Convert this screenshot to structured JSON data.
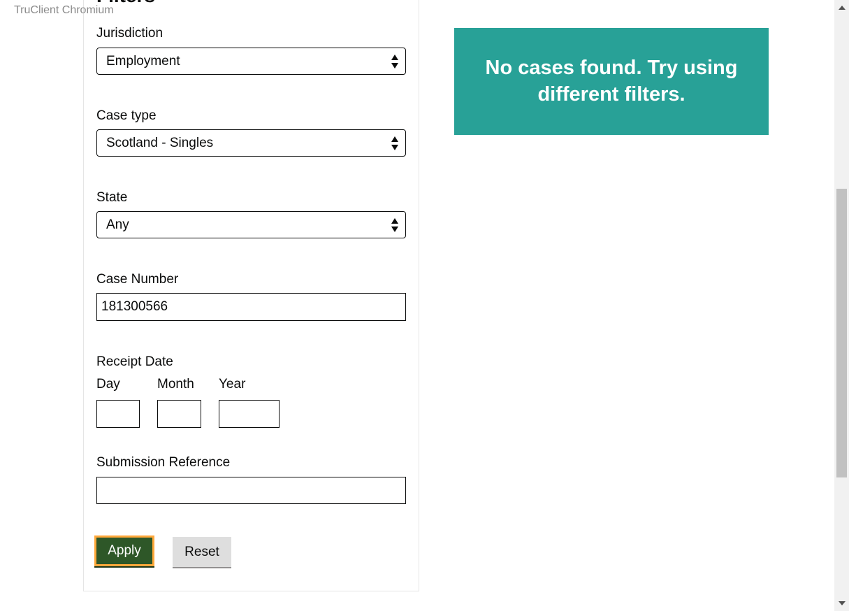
{
  "watermark": "TruClient Chromium",
  "panel": {
    "title": "Filters"
  },
  "filters": {
    "jurisdiction": {
      "label": "Jurisdiction",
      "value": "Employment"
    },
    "case_type": {
      "label": "Case type",
      "value": "Scotland - Singles"
    },
    "state": {
      "label": "State",
      "value": "Any"
    },
    "case_number": {
      "label": "Case Number",
      "value": "181300566"
    },
    "receipt_date": {
      "label": "Receipt Date",
      "day_label": "Day",
      "month_label": "Month",
      "year_label": "Year",
      "day": "",
      "month": "",
      "year": ""
    },
    "submission_reference": {
      "label": "Submission Reference",
      "value": ""
    }
  },
  "buttons": {
    "apply": "Apply",
    "reset": "Reset"
  },
  "notice": {
    "message": "No cases found. Try using different filters."
  },
  "colors": {
    "apply_bg": "#2e5728",
    "focus_outline": "#ffa83a",
    "notice_bg": "#28a197",
    "reset_bg": "#dedede"
  },
  "icons": {
    "select_arrows": "select-arrows-icon",
    "scroll_up": "scroll-up-arrow-icon",
    "scroll_down": "scroll-down-arrow-icon"
  }
}
